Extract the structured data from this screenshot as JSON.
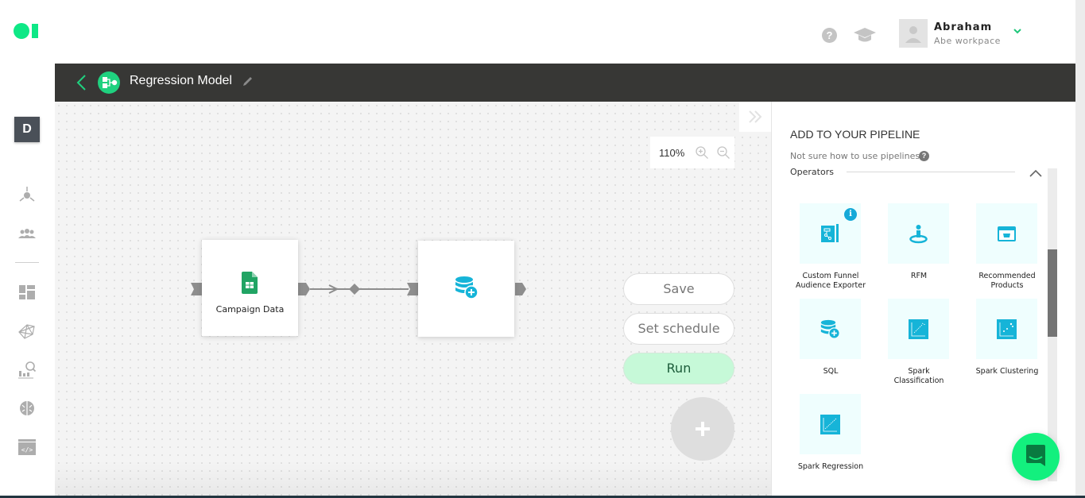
{
  "app": {
    "logo": "logo-icon",
    "top_icons": {
      "help": "help-icon",
      "learn": "graduation-cap-icon"
    },
    "user": {
      "name": "Abraham",
      "workspace": "Abe workpace"
    }
  },
  "header": {
    "title": "Regression Model",
    "back": "back-icon",
    "edit": "edit-icon"
  },
  "sidebar": {
    "workspace_initial": "D",
    "items": [
      {
        "name": "sources",
        "icon": "sources-icon"
      },
      {
        "name": "audiences",
        "icon": "users-icon"
      },
      {
        "name": "dashboard",
        "icon": "dashboard-icon"
      },
      {
        "name": "network",
        "icon": "network-icon"
      },
      {
        "name": "analytics",
        "icon": "analytics-icon"
      },
      {
        "name": "ai",
        "icon": "brain-icon"
      },
      {
        "name": "code",
        "icon": "code-icon"
      }
    ]
  },
  "canvas": {
    "zoom_level": "110%",
    "nodes": [
      {
        "label": "Campaign Data",
        "icon": "google-sheets-icon"
      },
      {
        "label": "",
        "icon": "database-add-icon"
      }
    ],
    "actions": {
      "save": "Save",
      "schedule": "Set schedule",
      "run": "Run",
      "add": "+"
    }
  },
  "panel": {
    "title": "ADD TO YOUR PIPELINE",
    "help_text": "Not sure how to use pipelines",
    "section": "Operators",
    "operators": [
      {
        "label_1": "Custom Funnel",
        "label_2": "Audience Exporter",
        "icon": "funnel-blueprint-icon",
        "info": "i"
      },
      {
        "label_1": "RFM",
        "label_2": "",
        "icon": "person-target-icon"
      },
      {
        "label_1": "Recommended",
        "label_2": "Products",
        "icon": "shop-basket-icon"
      },
      {
        "label_1": "SQL",
        "label_2": "",
        "icon": "database-add-icon"
      },
      {
        "label_1": "Spark",
        "label_2": "Classification",
        "icon": "scatter-chart-icon"
      },
      {
        "label_1": "Spark Clustering",
        "label_2": "",
        "icon": "cluster-chart-icon"
      },
      {
        "label_1": "Spark Regression",
        "label_2": "",
        "icon": "regression-chart-icon"
      }
    ]
  },
  "colors": {
    "brand": "#0ee886",
    "header": "#373735",
    "accent_blue": "#16b4d8",
    "run": "#c6f9d8"
  }
}
